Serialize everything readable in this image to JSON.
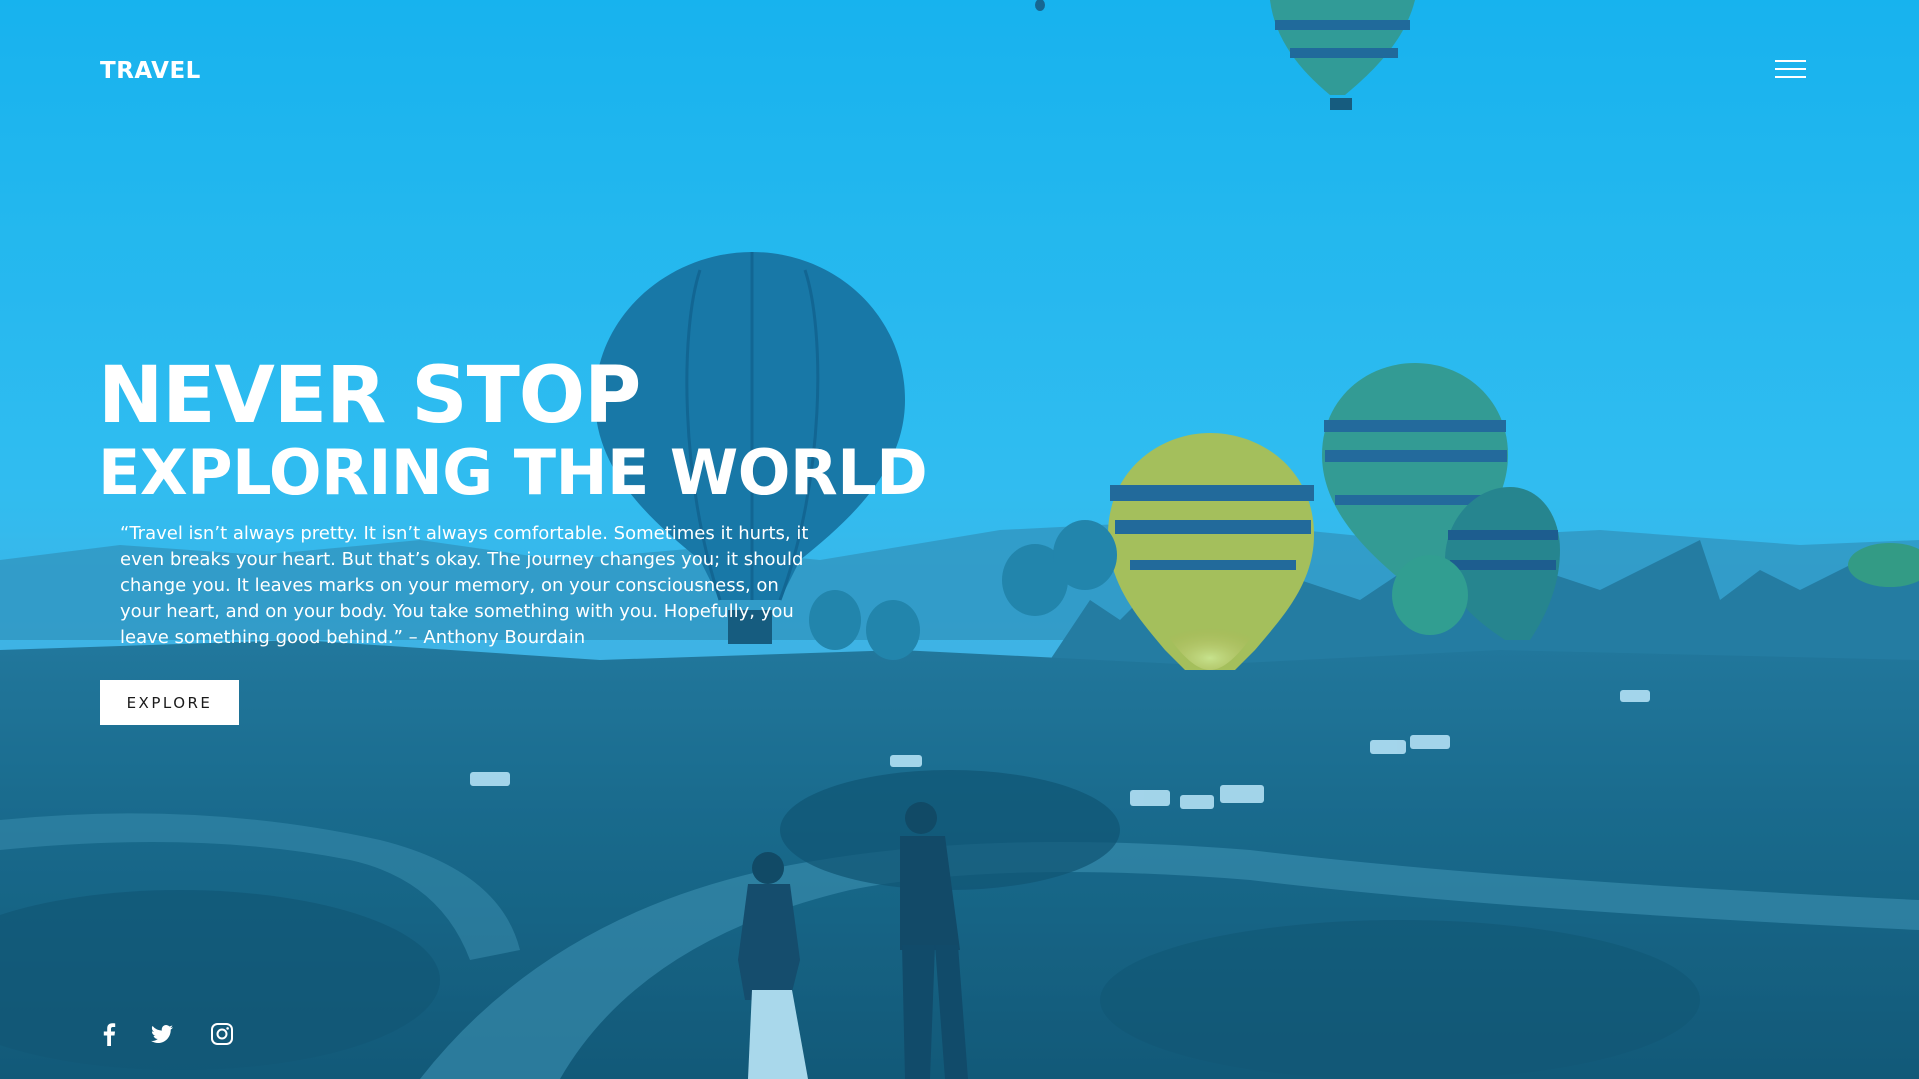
{
  "brand": {
    "name": "TRAVEL"
  },
  "nav": {
    "menu_icon": "hamburger-icon"
  },
  "hero": {
    "headline_line1": "NEVER STOP",
    "headline_line2": "EXPLORING THE WORLD",
    "quote": "“Travel isn’t always pretty. It isn’t always comfortable. Sometimes it hurts, it even breaks your heart. But that’s okay. The journey changes you; it should change you. It leaves marks on your memory, on your consciousness, on your heart, and on your body. You take something with you. Hopefully, you leave something good behind.” – Anthony Bourdain",
    "cta_label": "EXPLORE",
    "background": "hot-air-balloons-valley-photo"
  },
  "social": [
    {
      "name": "facebook",
      "icon": "facebook-icon"
    },
    {
      "name": "twitter",
      "icon": "twitter-icon"
    },
    {
      "name": "instagram",
      "icon": "instagram-icon"
    }
  ],
  "colors": {
    "sky": "#1fb8ee",
    "overlay": "#00a2ea",
    "text": "#ffffff",
    "button_bg": "#ffffff",
    "button_text": "#1a1a1a"
  }
}
